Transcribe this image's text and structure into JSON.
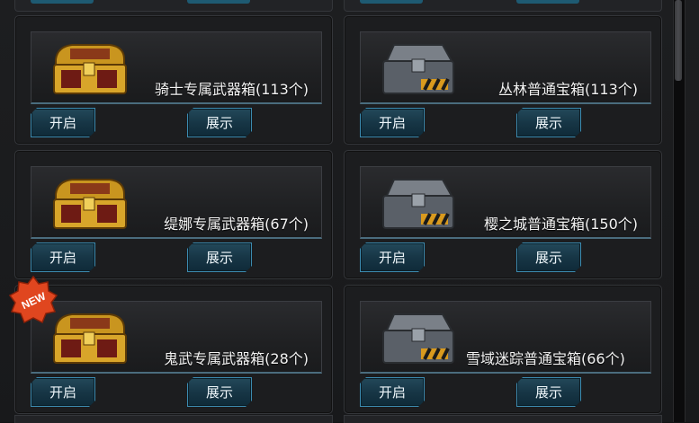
{
  "buttons": {
    "open": "开启",
    "show": "展示"
  },
  "chests": [
    {
      "name": "骑士专属武器箱(113个)",
      "style": "gold",
      "is_new": false
    },
    {
      "name": "丛林普通宝箱(113个)",
      "style": "steel",
      "is_new": false
    },
    {
      "name": "缇娜专属武器箱(67个)",
      "style": "gold",
      "is_new": false
    },
    {
      "name": "樱之城普通宝箱(150个)",
      "style": "steel",
      "is_new": false
    },
    {
      "name": "鬼武专属武器箱(28个)",
      "style": "gold",
      "is_new": true
    },
    {
      "name": "雪域迷踪普通宝箱(66个)",
      "style": "steel",
      "is_new": false
    }
  ],
  "badge": {
    "new_label": "NEW"
  },
  "colors": {
    "accent": "#3c8bb0",
    "gold": "#d8a52a",
    "steel": "#5a6068",
    "new_badge": "#e0461f"
  }
}
